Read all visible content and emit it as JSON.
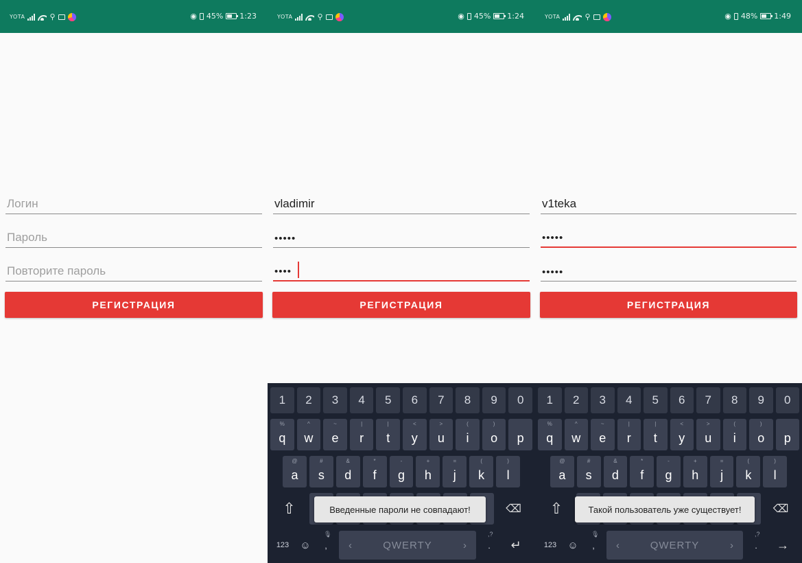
{
  "colors": {
    "status_bar": "#0e7a5e",
    "accent": "#e53935",
    "keyboard_bg": "#1c2230",
    "key_bg": "#3b4152",
    "toast_bg": "#e6e6e6"
  },
  "screens": [
    {
      "status": {
        "carrier": "YOTA",
        "battery": "45%",
        "time": "1:23"
      },
      "fields": {
        "login_placeholder": "Логин",
        "password_placeholder": "Пароль",
        "repeat_placeholder": "Повторите пароль",
        "login_value": "",
        "password_value": "",
        "repeat_value": ""
      },
      "register_button": "РЕГИСТРАЦИЯ"
    },
    {
      "status": {
        "carrier": "YOTA",
        "battery": "45%",
        "time": "1:24"
      },
      "fields": {
        "login_placeholder": "Логин",
        "password_placeholder": "Пароль",
        "repeat_placeholder": "Повторите пароль",
        "login_value": "vladimir",
        "password_value": "•••••",
        "repeat_value": "••••"
      },
      "register_button": "РЕГИСТРАЦИЯ",
      "toast": "Введенные пароли не совпадают!"
    },
    {
      "status": {
        "carrier": "YOTA",
        "battery": "48%",
        "time": "1:49"
      },
      "fields": {
        "login_placeholder": "Логин",
        "password_placeholder": "Пароль",
        "repeat_placeholder": "Повторите пароль",
        "login_value": "v1teka",
        "password_value": "•••••",
        "repeat_value": "•••••"
      },
      "register_button": "РЕГИСТРАЦИЯ",
      "toast": "Такой пользователь уже существует!"
    }
  ],
  "keyboard": {
    "numbers": [
      "1",
      "2",
      "3",
      "4",
      "5",
      "6",
      "7",
      "8",
      "9",
      "0"
    ],
    "row_q": {
      "keys": [
        "q",
        "w",
        "e",
        "r",
        "t",
        "y",
        "u",
        "i",
        "o",
        "p"
      ],
      "hints": [
        "%",
        "^",
        "~",
        "|",
        "|",
        "<",
        ">",
        "(",
        ")",
        ""
      ]
    },
    "row_a": {
      "keys": [
        "a",
        "s",
        "d",
        "f",
        "g",
        "h",
        "j",
        "k",
        "l"
      ],
      "hints": [
        "@",
        "#",
        "&",
        "*",
        "-",
        "+",
        "=",
        "(",
        ")"
      ]
    },
    "space_label": "QWERTY",
    "mode_key": "123",
    "comma": ",",
    "period": ".",
    "icons": {
      "shift": "shift-icon",
      "backspace": "backspace-icon",
      "emoji": "emoji-icon",
      "mic": "mic-icon"
    },
    "enter_icons": [
      "enter-icon",
      "next-arrow-icon"
    ]
  }
}
